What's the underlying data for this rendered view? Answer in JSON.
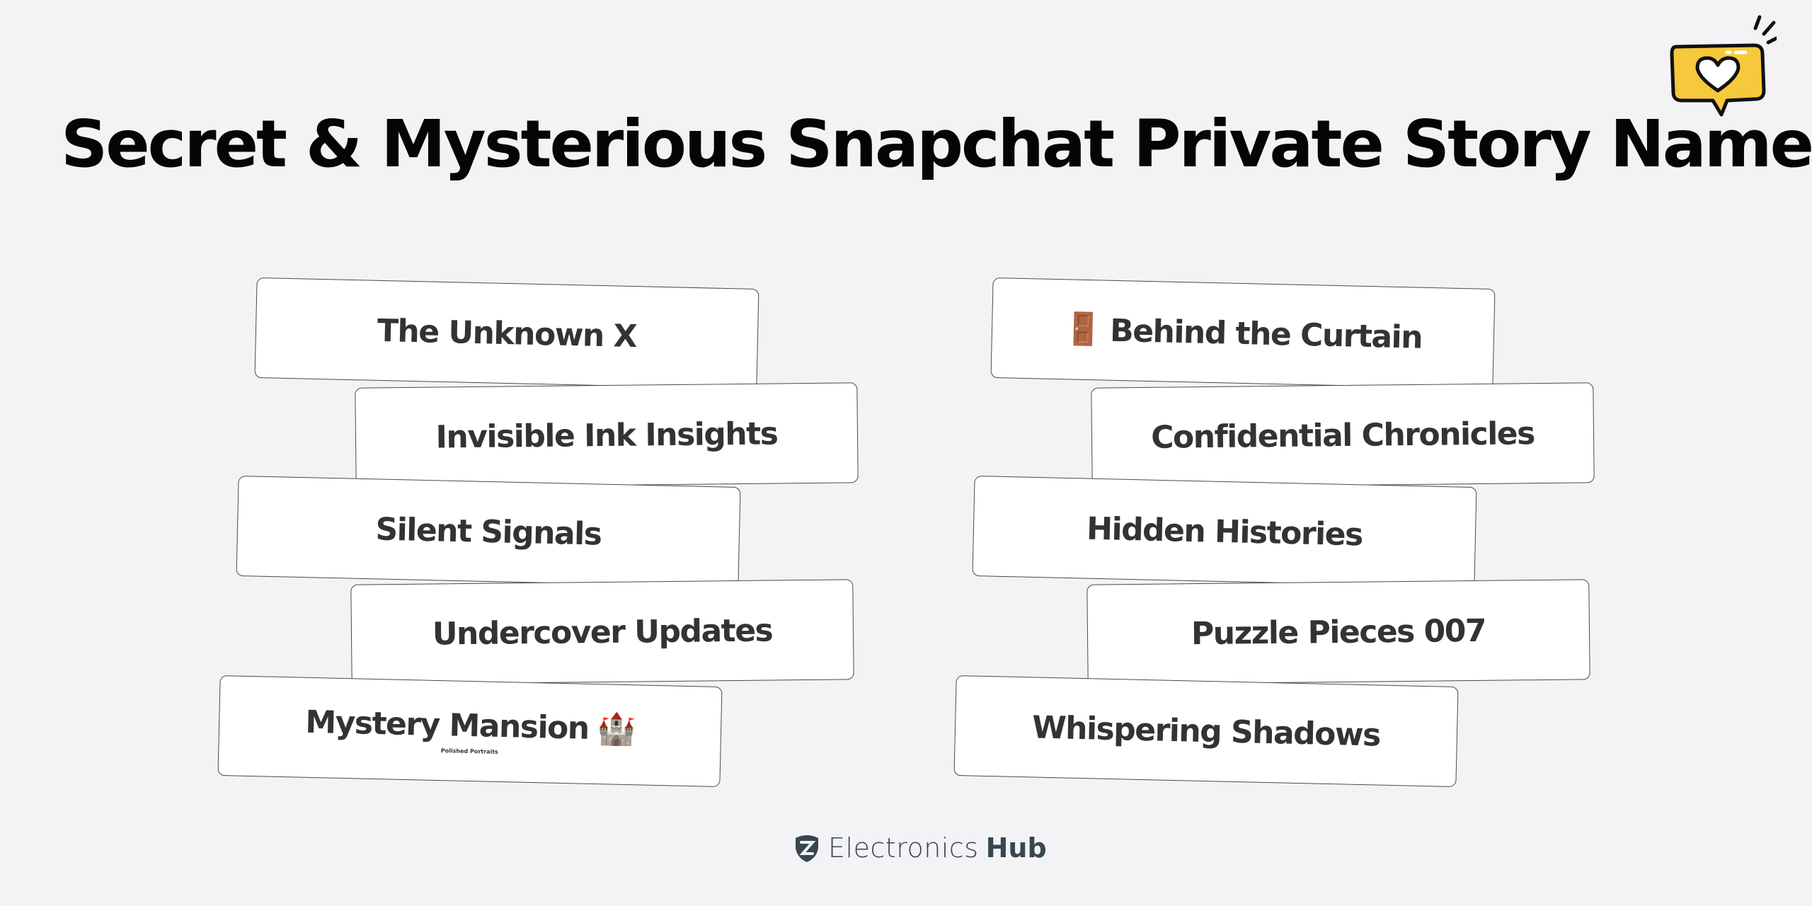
{
  "title": "Secret & Mysterious Snapchat Private Story Names",
  "sticker": {
    "icon": "heart-speech-bubble-icon",
    "fill": "#f6c93c",
    "stroke": "#111111"
  },
  "cards_left": [
    {
      "label": "The Unknown X",
      "emoji": ""
    },
    {
      "label": "Invisible Ink Insights",
      "emoji": ""
    },
    {
      "label": "Silent Signals",
      "emoji": ""
    },
    {
      "label": "Undercover Updates",
      "emoji": ""
    },
    {
      "label": "Mystery Mansion",
      "emoji": "🏰",
      "sublabel": "Polished Portraits"
    }
  ],
  "cards_right": [
    {
      "label": "Behind the Curtain",
      "emoji": "🚪"
    },
    {
      "label": "Confidential Chronicles",
      "emoji": ""
    },
    {
      "label": "Hidden Histories",
      "emoji": ""
    },
    {
      "label": "Puzzle Pieces 007",
      "emoji": ""
    },
    {
      "label": "Whispering Shadows",
      "emoji": ""
    }
  ],
  "footer": {
    "brand_light": "Electronics",
    "brand_bold": "Hub",
    "logo_icon": "shield-logo-icon"
  }
}
